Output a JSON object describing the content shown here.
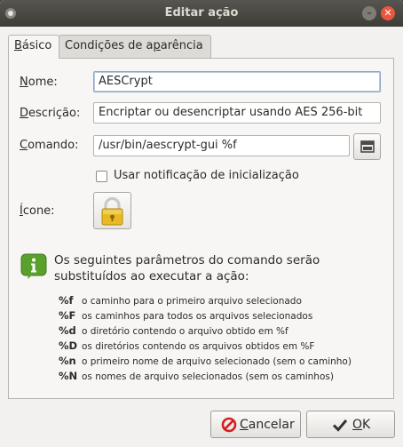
{
  "window": {
    "title": "Editar ação"
  },
  "tabs": [
    {
      "prefix": "",
      "mnemonic": "B",
      "rest": "ásico"
    },
    {
      "prefix": "Condições de a",
      "mnemonic": "p",
      "rest": "arência"
    }
  ],
  "form": {
    "name": {
      "mnemonic": "N",
      "rest": "ome:",
      "value": "AESCrypt"
    },
    "description": {
      "mnemonic": "D",
      "rest": "escrição:",
      "value": "Encriptar ou desencriptar usando AES 256-bit"
    },
    "command": {
      "mnemonic": "C",
      "rest": "omando:",
      "value": "/usr/bin/aescrypt-gui %f"
    },
    "startup_notify": {
      "label": "Usar notificação de inicialização",
      "checked": false
    },
    "icon": {
      "mnemonic": "Í",
      "rest": "cone:"
    }
  },
  "info": {
    "text": "Os seguintes parâmetros do comando serão substituídos ao executar a ação:",
    "params": [
      {
        "code": "%f",
        "desc": "o caminho para o primeiro arquivo selecionado"
      },
      {
        "code": "%F",
        "desc": "os caminhos para todos os arquivos selecionados"
      },
      {
        "code": "%d",
        "desc": "o diretório contendo o arquivo obtido em %f"
      },
      {
        "code": "%D",
        "desc": "os diretórios contendo os arquivos obtidos em %F"
      },
      {
        "code": "%n",
        "desc": "o primeiro nome de arquivo selecionado (sem o caminho)"
      },
      {
        "code": "%N",
        "desc": "os nomes de arquivo selecionados (sem os caminhos)"
      }
    ]
  },
  "buttons": {
    "cancel": {
      "mnemonic": "C",
      "rest": "ancelar"
    },
    "ok": {
      "mnemonic": "O",
      "rest": "K"
    }
  },
  "icons": {
    "menu": "window-menu-icon",
    "minimize": "minimize-icon",
    "close": "close-icon",
    "browse": "folder-open-icon",
    "app": "padlock-icon",
    "info": "info-icon",
    "cancel": "cancel-icon",
    "ok": "checkmark-icon"
  },
  "colors": {
    "titlebar": "#3d3c37",
    "close": "#e9573e",
    "info_green": "#5aa02c",
    "padlock": "#e8b923"
  }
}
